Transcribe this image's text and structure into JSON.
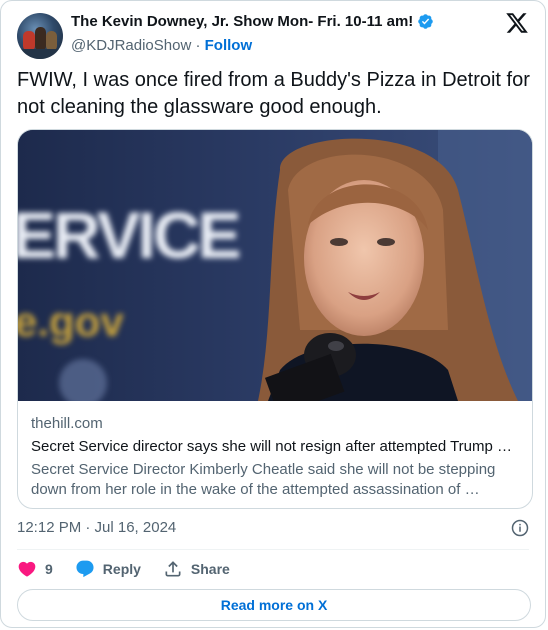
{
  "tweet": {
    "author": {
      "display_name": "The Kevin Downey, Jr. Show Mon- Fri. 10-11 am!",
      "handle": "@KDJRadioShow",
      "separator": " · ",
      "follow_label": "Follow",
      "verified": true
    },
    "text": "FWIW, I was once fired from a Buddy's Pizza in Detroit for not cleaning the glassware good enough.",
    "link_card": {
      "domain": "thehill.com",
      "headline": "Secret Service director says she will not resign after attempted Trump assassination",
      "description": "Secret Service Director Kimberly Cheatle said she will not be stepping down from her role in the wake of the attempted assassination of …",
      "image_text_1": "ERVICE",
      "image_text_2": "e.gov"
    },
    "timestamp": "12:12 PM · Jul 16, 2024",
    "actions": {
      "like_count": "9",
      "reply_label": "Reply",
      "share_label": "Share"
    },
    "read_more_label": "Read more on X"
  },
  "colors": {
    "text": "#0f1419",
    "secondary": "#536471",
    "link": "#006fd6",
    "like": "#f91880",
    "reply": "#1d9bf0",
    "border": "#cfd9de"
  },
  "icons": [
    "verified-badge-icon",
    "x-logo-icon",
    "info-icon",
    "heart-icon",
    "reply-bubble-icon",
    "share-icon"
  ]
}
